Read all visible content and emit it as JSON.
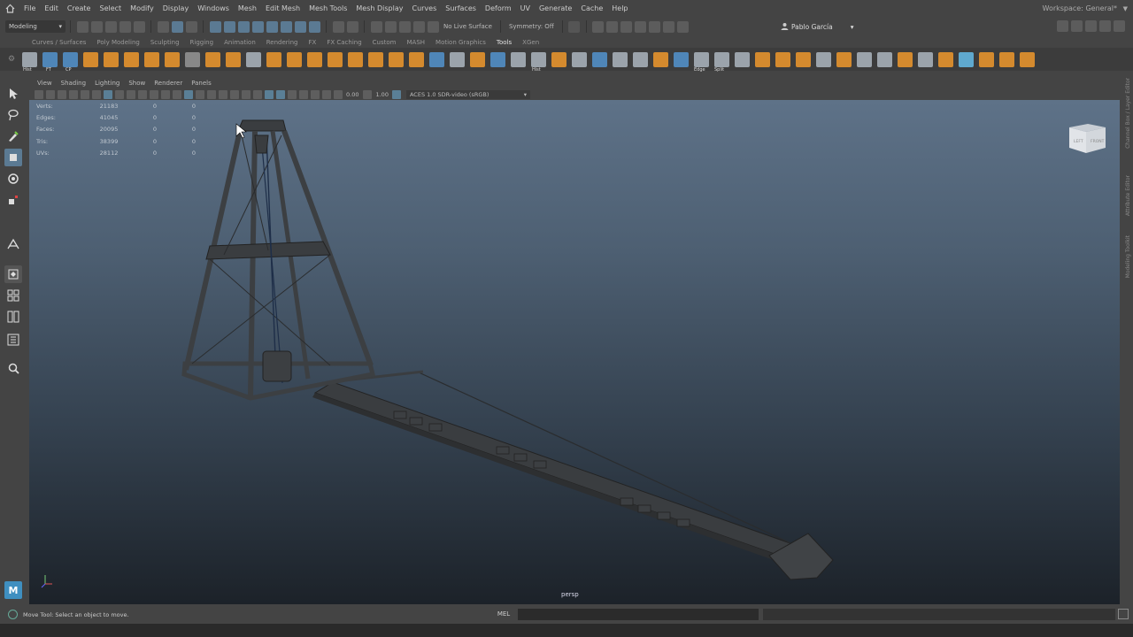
{
  "menubar": {
    "items": [
      "File",
      "Edit",
      "Create",
      "Select",
      "Modify",
      "Display",
      "Windows",
      "Mesh",
      "Edit Mesh",
      "Mesh Tools",
      "Mesh Display",
      "Curves",
      "Surfaces",
      "Deform",
      "UV",
      "Generate",
      "Cache",
      "Help"
    ],
    "workspace": "Workspace: General*"
  },
  "statusline": {
    "mode": "Modeling",
    "live_surface": "No Live Surface",
    "symmetry": "Symmetry: Off",
    "user": "Pablo García"
  },
  "shelf": {
    "tabs": [
      "Curves / Surfaces",
      "Poly Modeling",
      "Sculpting",
      "Rigging",
      "Animation",
      "Rendering",
      "FX",
      "FX Caching",
      "Custom",
      "MASH",
      "Motion Graphics",
      "Tools",
      "XGen"
    ],
    "active_tab": "Tools",
    "icon_labels": {
      "hist": "Hist",
      "ft": "FT",
      "cp": "CP",
      "hist2": "Hist",
      "edge": "Edge",
      "split": "Split"
    }
  },
  "panel": {
    "menus": [
      "View",
      "Shading",
      "Lighting",
      "Show",
      "Renderer",
      "Panels"
    ],
    "exposure": "0.00",
    "gamma": "1.00",
    "color_space": "ACES 1.0 SDR-video (sRGB)",
    "camera": "persp"
  },
  "hud": [
    {
      "label": "Verts:",
      "v1": "21183",
      "v2": "0",
      "v3": "0"
    },
    {
      "label": "Edges:",
      "v1": "41045",
      "v2": "0",
      "v3": "0"
    },
    {
      "label": "Faces:",
      "v1": "20095",
      "v2": "0",
      "v3": "0"
    },
    {
      "label": "Tris:",
      "v1": "38399",
      "v2": "0",
      "v3": "0"
    },
    {
      "label": "UVs:",
      "v1": "28112",
      "v2": "0",
      "v3": "0"
    }
  ],
  "viewcube": {
    "left": "LEFT",
    "front": "FRONT"
  },
  "right_rail": [
    "Channel Box / Layer Editor",
    "Attribute Editor",
    "Modeling Toolkit"
  ],
  "cmdline": {
    "help": "Move Tool: Select an object to move.",
    "language": "MEL"
  },
  "colors": {
    "accent": "#5b7a93",
    "shelf_orange": "#d48a2e",
    "maya_logo": "#3f8fc0"
  }
}
